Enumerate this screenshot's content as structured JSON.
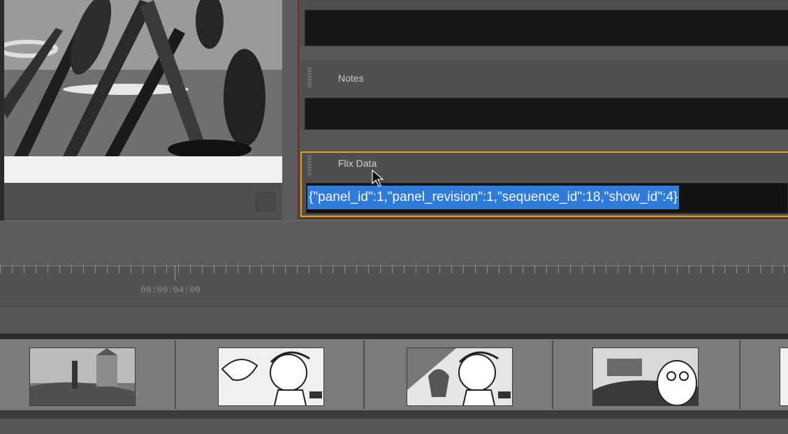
{
  "metadata": {
    "notes_label": "Notes",
    "flix_label": "Flix Data",
    "flix_value": "{\"panel_id\":1,\"panel_revision\":1,\"sequence_id\":18,\"show_id\":4}"
  },
  "timeline": {
    "timecode": "00:00:04:00"
  },
  "colors": {
    "selection": "#2f7bd8",
    "focus_border": "#e0a21a",
    "panel_border": "#6b2e2e"
  },
  "icons": {
    "cursor": "arrow-cursor-icon",
    "grip": "drag-handle-icon"
  }
}
